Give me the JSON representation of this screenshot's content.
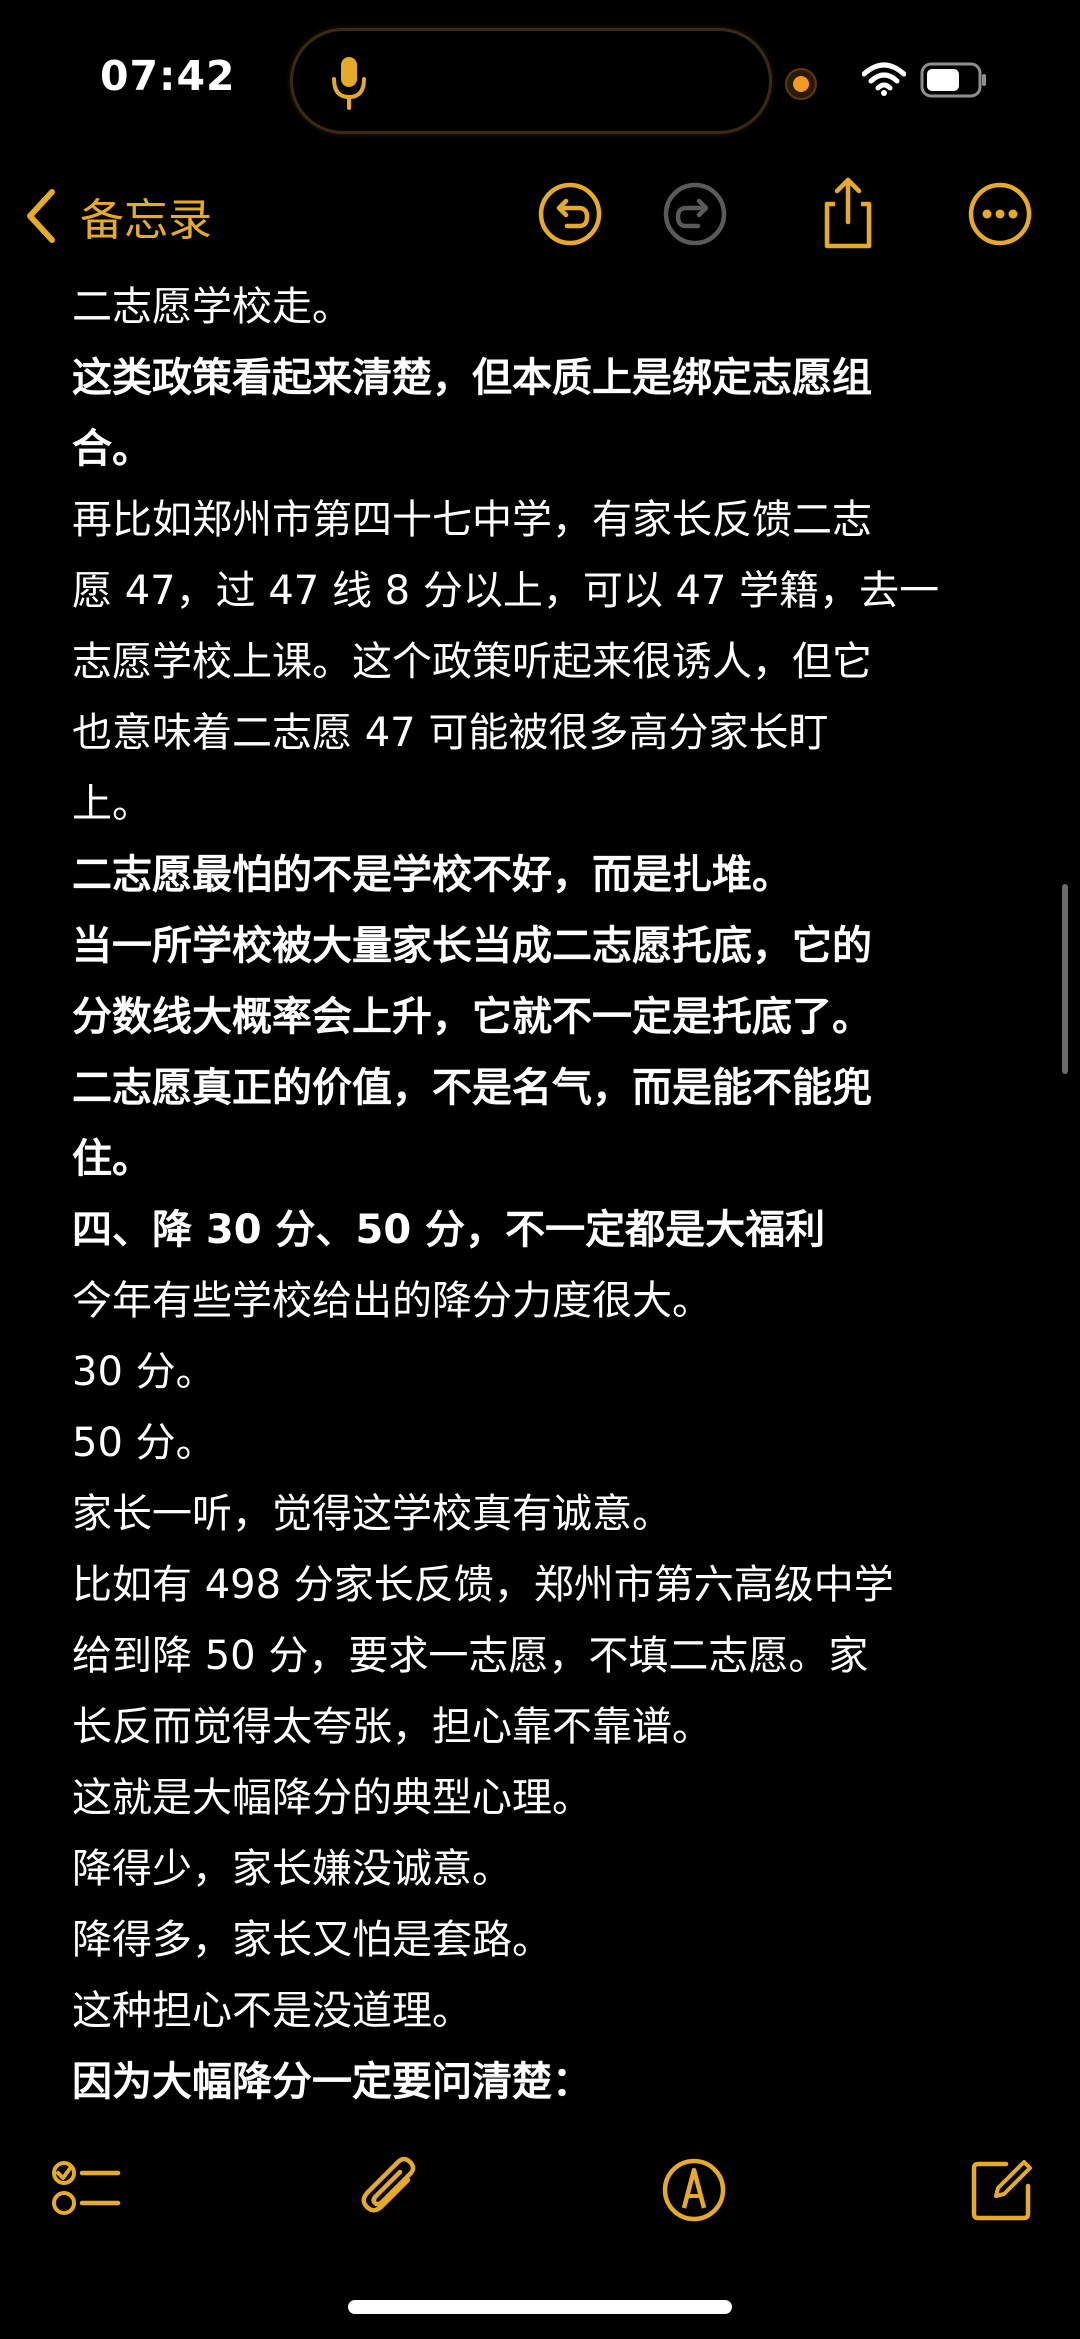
{
  "status_bar": {
    "time": "07:42",
    "icons": [
      "microphone-icon",
      "recording-dot-icon",
      "wifi-icon",
      "battery-icon"
    ]
  },
  "nav": {
    "back_label": "备忘录",
    "icons": [
      "undo-icon",
      "redo-icon",
      "share-icon",
      "more-icon"
    ]
  },
  "colors": {
    "accent": "#e5ab28",
    "background": "#000000",
    "text": "#ffffff",
    "disabled_icon": "#5a5a5a",
    "recording_dot": "#f39a1e"
  },
  "note": {
    "lines": [
      {
        "text": "二志愿学校走。",
        "bold": false
      },
      {
        "text": "这类政策看起来清楚，但本质上是绑定志愿组",
        "bold": true
      },
      {
        "text": "合。",
        "bold": true
      },
      {
        "text": "再比如郑州市第四十七中学，有家长反馈二志",
        "bold": false
      },
      {
        "text": "愿 47，过 47 线 8 分以上，可以 47 学籍，去一",
        "bold": false
      },
      {
        "text": "志愿学校上课。这个政策听起来很诱人，但它",
        "bold": false
      },
      {
        "text": "也意味着二志愿 47 可能被很多高分家长盯",
        "bold": false
      },
      {
        "text": "上。",
        "bold": false
      },
      {
        "text": "二志愿最怕的不是学校不好，而是扎堆。",
        "bold": true
      },
      {
        "text": "当一所学校被大量家长当成二志愿托底，它的",
        "bold": true
      },
      {
        "text": "分数线大概率会上升，它就不一定是托底了。",
        "bold": true
      },
      {
        "text": "二志愿真正的价值，不是名气，而是能不能兜",
        "bold": true
      },
      {
        "text": "住。",
        "bold": true
      },
      {
        "text": "四、降 30 分、50 分，不一定都是大福利",
        "bold": true
      },
      {
        "text": "今年有些学校给出的降分力度很大。",
        "bold": false
      },
      {
        "text": "30 分。",
        "bold": false
      },
      {
        "text": "50 分。",
        "bold": false
      },
      {
        "text": "家长一听，觉得这学校真有诚意。",
        "bold": false
      },
      {
        "text": "比如有 498 分家长反馈，郑州市第六高级中学",
        "bold": false
      },
      {
        "text": "给到降 50 分，要求一志愿，不填二志愿。家",
        "bold": false
      },
      {
        "text": "长反而觉得太夸张，担心靠不靠谱。",
        "bold": false
      },
      {
        "text": "这就是大幅降分的典型心理。",
        "bold": false
      },
      {
        "text": "降得少，家长嫌没诚意。",
        "bold": false
      },
      {
        "text": "降得多，家长又怕是套路。",
        "bold": false
      },
      {
        "text": "这种担心不是没道理。",
        "bold": false
      },
      {
        "text": "因为大幅降分一定要问清楚：",
        "bold": true
      }
    ]
  },
  "toolbar": {
    "icons": [
      "checklist-icon",
      "attachment-icon",
      "markup-icon",
      "compose-icon"
    ]
  }
}
